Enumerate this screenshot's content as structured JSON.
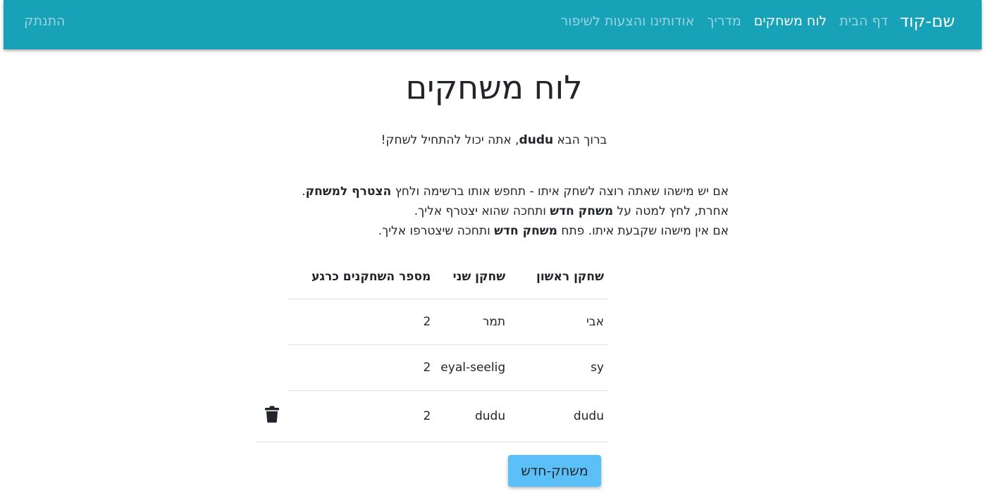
{
  "navbar": {
    "brand": "שם-קוד",
    "links": [
      {
        "label": "דף הבית",
        "active": false
      },
      {
        "label": "לוח משחקים",
        "active": true
      },
      {
        "label": "מדריך",
        "active": false
      },
      {
        "label": "אודותינו והצעות לשיפור",
        "active": false
      }
    ],
    "logout": "התנתק",
    "color": "#17a2b8"
  },
  "page": {
    "title": "לוח משחקים",
    "welcome_prefix": "ברוך הבא ",
    "username": "dudu",
    "welcome_suffix": ", אתה יכול להתחיל לשחק!"
  },
  "instructions": {
    "line1_text": "אם יש מישהו שאתה רוצה לשחק איתו - תחפש אותו ברשימה ולחץ ",
    "line1_bold": "הצטרף למשחק",
    "line1_end": ".",
    "line2_text": "אחרת, לחץ למטה על ",
    "line2_bold": "משחק חדש",
    "line2_end": " ותחכה שהוא יצטרף אליך.",
    "line3_text": "אם אין מישהו שקבעת איתו. פתח ",
    "line3_bold": "משחק חדש",
    "line3_end": " ותחכה שיצטרפו אליך."
  },
  "table": {
    "headers": [
      "שחקן ראשון",
      "שחקן שני",
      "מספר השחקנים כרגע"
    ],
    "rows": [
      [
        "אבי",
        "תמר",
        "2"
      ],
      [
        "sy",
        "eyal-seelig",
        "2"
      ],
      [
        "dudu",
        "dudu",
        "2"
      ]
    ]
  },
  "actions": {
    "delete_icon": "trash-icon",
    "new_game_label": "משחק-חדש",
    "button_color": "#5bc0f8"
  }
}
